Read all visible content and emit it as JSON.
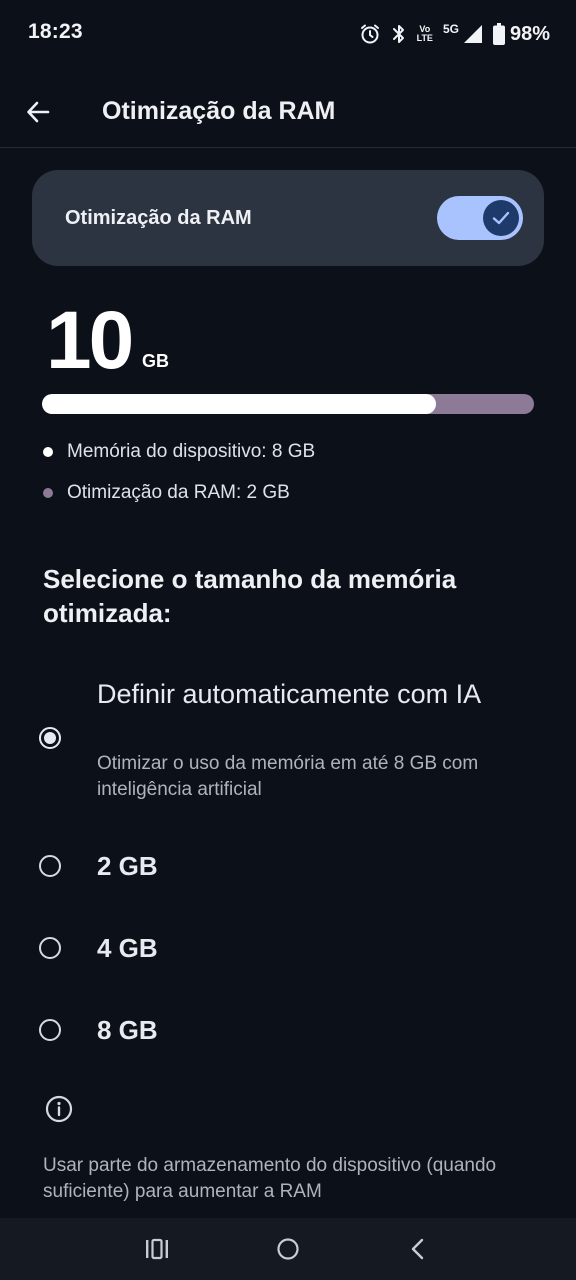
{
  "status_bar": {
    "time": "18:23",
    "volte_top": "Vo",
    "volte_bottom": "LTE",
    "network": "5G",
    "battery": "98%",
    "icons": [
      "alarm-icon",
      "bluetooth-icon",
      "volte-icon",
      "signal-icon",
      "battery-icon"
    ]
  },
  "header": {
    "back_icon": "arrow-left-icon",
    "title": "Otimização da RAM"
  },
  "toggle_card": {
    "label": "Otimização da RAM",
    "enabled": true,
    "accent": "#a9c3ff"
  },
  "memory": {
    "total_value": "10",
    "total_unit": "GB",
    "device_fraction": 0.8,
    "legend": [
      {
        "label": "Memória do dispositivo: 8 GB",
        "color": "#ffffff"
      },
      {
        "label": "Otimização da RAM: 2 GB",
        "color": "#8d7a97"
      }
    ]
  },
  "selection": {
    "heading": "Selecione o tamanho da memória otimizada:",
    "options": [
      {
        "title": "Definir automaticamente com IA",
        "subtitle": "Otimizar o uso da memória em até 8 GB com inteligência artificial",
        "selected": true
      },
      {
        "title": "2 GB",
        "selected": false
      },
      {
        "title": "4 GB",
        "selected": false
      },
      {
        "title": "8 GB",
        "selected": false
      }
    ]
  },
  "info": {
    "icon": "info-icon",
    "text": "Usar parte do armazenamento do dispositivo (quando suficiente) para aumentar a RAM"
  },
  "nav_bar": {
    "icons": [
      "recents-icon",
      "home-icon",
      "back-icon"
    ]
  }
}
